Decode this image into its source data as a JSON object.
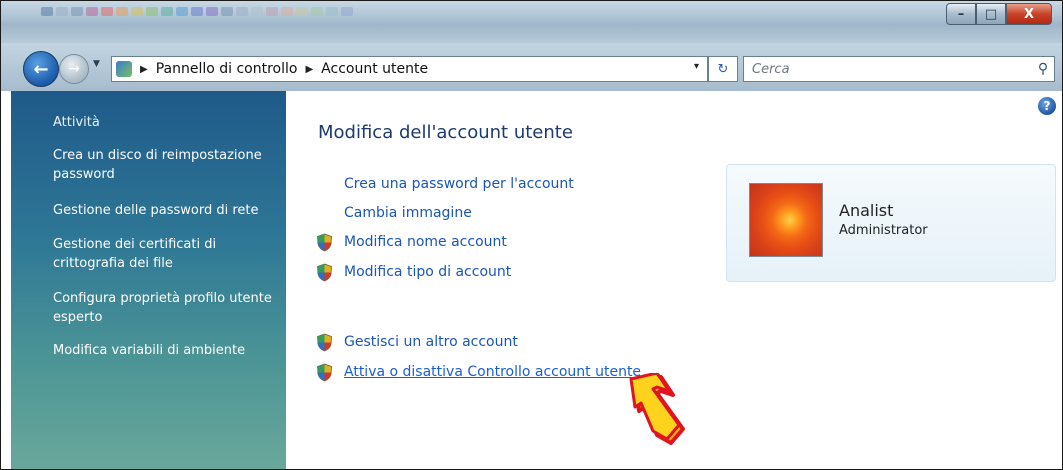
{
  "window": {
    "minimize_label": "–",
    "maximize_label": "□",
    "close_label": "X"
  },
  "nav": {
    "back_label": "←",
    "forward_label": "→",
    "dropdown_label": "▼"
  },
  "address": {
    "crumbs": [
      "Pannello di controllo",
      "Account utente"
    ],
    "separator": "▶",
    "dropdown_label": "▾",
    "refresh_label": "↻"
  },
  "search": {
    "placeholder": "Cerca",
    "icon_label": "⚲"
  },
  "sidebar": {
    "heading": "Attività",
    "items": [
      {
        "label": "Crea un disco di reimpostazione password"
      },
      {
        "label": "Gestione delle password di rete"
      },
      {
        "label": "Gestione dei certificati di crittografia dei file"
      },
      {
        "label": "Configura proprietà profilo utente esperto"
      },
      {
        "label": "Modifica variabili di ambiente"
      }
    ]
  },
  "main": {
    "help_label": "?",
    "title": "Modifica dell'account utente",
    "tasks": [
      {
        "label": "Crea una password per l'account",
        "shield": false
      },
      {
        "label": "Cambia immagine",
        "shield": false
      },
      {
        "label": "Modifica nome account",
        "shield": true
      },
      {
        "label": "Modifica tipo di account",
        "shield": true
      },
      {
        "label": "Gestisci un altro account",
        "shield": true
      },
      {
        "label": "Attiva o disattiva Controllo account utente",
        "shield": true,
        "hover": true
      }
    ]
  },
  "account": {
    "name": "Analist",
    "role": "Administrator"
  },
  "colors": {
    "link": "#1a56b6",
    "title": "#1e3a6e",
    "sidebar_top": "#1f5a8a",
    "sidebar_bottom": "#6aa89a",
    "arrow_fill": "#ffd21e",
    "arrow_outline": "#e0141e"
  }
}
